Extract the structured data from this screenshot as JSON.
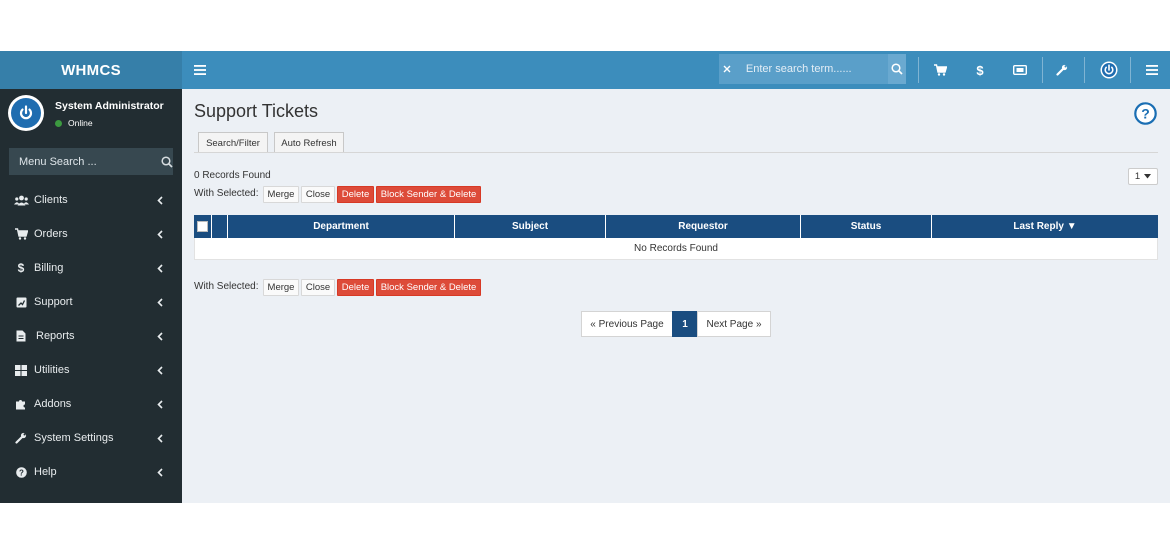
{
  "header": {
    "brand": "WHMCS",
    "search_placeholder": "Enter search term......",
    "icons": [
      "menu-icon",
      "close-icon",
      "search-icon",
      "cart-icon",
      "dollar-icon",
      "ticket-icon",
      "wrench-icon",
      "power-icon",
      "menu-icon"
    ]
  },
  "user": {
    "name": "System Administrator",
    "status": "Online",
    "status_color": "#3c9a40"
  },
  "sidebar": {
    "search_placeholder": "Menu Search ...",
    "items": [
      {
        "label": "Clients",
        "icon": "users-icon"
      },
      {
        "label": "Orders",
        "icon": "cart-icon"
      },
      {
        "label": "Billing",
        "icon": "dollar-icon"
      },
      {
        "label": "Support",
        "icon": "support-icon"
      },
      {
        "label": "Reports",
        "icon": "document-icon"
      },
      {
        "label": "Utilities",
        "icon": "grid-icon"
      },
      {
        "label": "Addons",
        "icon": "puzzle-icon"
      },
      {
        "label": "System Settings",
        "icon": "wrench-icon"
      },
      {
        "label": "Help",
        "icon": "question-icon"
      }
    ]
  },
  "main": {
    "title": "Support Tickets",
    "tabs": [
      "Search/Filter",
      "Auto Refresh"
    ],
    "records_found": "0 Records Found",
    "page_select": "1",
    "with_selected": "With Selected:",
    "actions": {
      "merge": "Merge",
      "close": "Close",
      "delete": "Delete",
      "block_delete": "Block Sender & Delete"
    },
    "table": {
      "columns": [
        "Department",
        "Subject",
        "Requestor",
        "Status",
        "Last Reply ▼"
      ],
      "empty_text": "No Records Found"
    },
    "pagination": {
      "prev": "« Previous Page",
      "current": "1",
      "next": "Next Page »"
    }
  },
  "colors": {
    "topbar": "#3c8dbc",
    "logo_bg": "#367fa9",
    "sidebar_bg": "#222d32",
    "table_header": "#1a4d80",
    "danger": "#dd4b39"
  }
}
